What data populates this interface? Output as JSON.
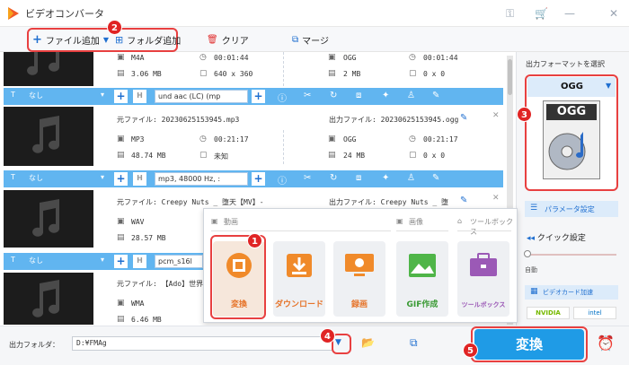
{
  "app": {
    "title": "ビデオコンバータ"
  },
  "toolbar": {
    "add_file": "ファイル追加",
    "add_folder": "フォルダ追加",
    "clear": "クリア",
    "merge": "マージ"
  },
  "rows": [
    {
      "src_format": "M4A",
      "src_duration": "00:01:44",
      "src_size": "3.06 MB",
      "src_res": "640 x 360",
      "dst_format": "OGG",
      "dst_duration": "00:01:44",
      "dst_size": "2 MB",
      "dst_res": "0 x 0",
      "subtitle": "なし",
      "audio": "und aac (LC) (mp"
    },
    {
      "src_name": "元ファイル: 20230625153945.mp3",
      "dst_name": "出力ファイル: 20230625153945.ogg",
      "src_format": "MP3",
      "src_duration": "00:21:17",
      "src_size": "48.74 MB",
      "src_res": "未知",
      "dst_format": "OGG",
      "dst_duration": "00:21:17",
      "dst_size": "24 MB",
      "dst_res": "0 x 0",
      "subtitle": "なし",
      "audio": "mp3, 48000 Hz, :"
    },
    {
      "src_name": "元ファイル: Creepy Nuts _ 堕天【MV】-",
      "dst_name": "出力ファイル: Creepy Nuts _ 堕",
      "src_format": "WAV",
      "src_size": "28.57 MB",
      "subtitle": "なし",
      "audio": "pcm_s16l"
    },
    {
      "src_name": "元ファイル: 【Ado】世界",
      "src_format": "WMA",
      "src_size": "6.46 MB"
    }
  ],
  "popup": {
    "cat_video": "動画",
    "cat_image": "画像",
    "cat_toolbox": "ツールボックス",
    "tiles": [
      "変換",
      "ダウンロード",
      "録画",
      "GIF作成",
      "ツールボックス"
    ]
  },
  "right": {
    "output_format_label": "出力フォーマットを選択",
    "format": "OGG",
    "format_icon_text": "OGG",
    "param_settings": "パラメータ設定",
    "quick_settings": "クイック設定",
    "auto": "自動",
    "gpu_accel": "ビデオカード加速",
    "vendor_nvidia": "NVIDIA",
    "vendor_intel": "intel"
  },
  "bottom": {
    "output_folder_label": "出力フォルダ：",
    "output_folder_value": "D:¥FMAg",
    "convert": "変換"
  },
  "badges": [
    "1",
    "2",
    "3",
    "4",
    "5"
  ],
  "colors": {
    "accent": "#1f9be6",
    "bluebar": "#61b5f0",
    "badge": "#e02424",
    "convert": "#1f9be6"
  }
}
